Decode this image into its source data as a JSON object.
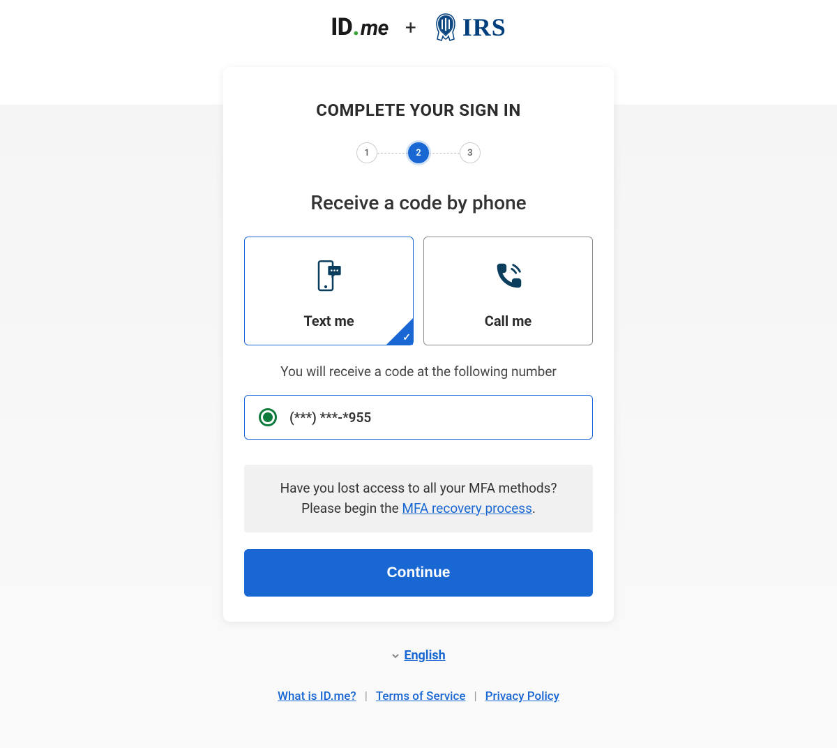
{
  "logos": {
    "idme_id": "ID",
    "idme_me": "me",
    "plus": "+",
    "irs": "IRS"
  },
  "card": {
    "title": "COMPLETE YOUR SIGN IN",
    "steps": [
      "1",
      "2",
      "3"
    ],
    "active_step": 2,
    "subtitle": "Receive a code by phone"
  },
  "options": {
    "text": "Text me",
    "call": "Call me",
    "selected": "text"
  },
  "helper": "You will receive a code at the following number",
  "phone": {
    "masked": "(***) ***-*955",
    "selected": true
  },
  "notice": {
    "line1": "Have you lost access to all your MFA methods?",
    "line2_prefix": "Please begin the ",
    "link": "MFA recovery process",
    "line2_suffix": "."
  },
  "continue": "Continue",
  "footer": {
    "language": "English",
    "links": {
      "what_is": "What is ID.me?",
      "terms": "Terms of Service",
      "privacy": "Privacy Policy"
    }
  }
}
